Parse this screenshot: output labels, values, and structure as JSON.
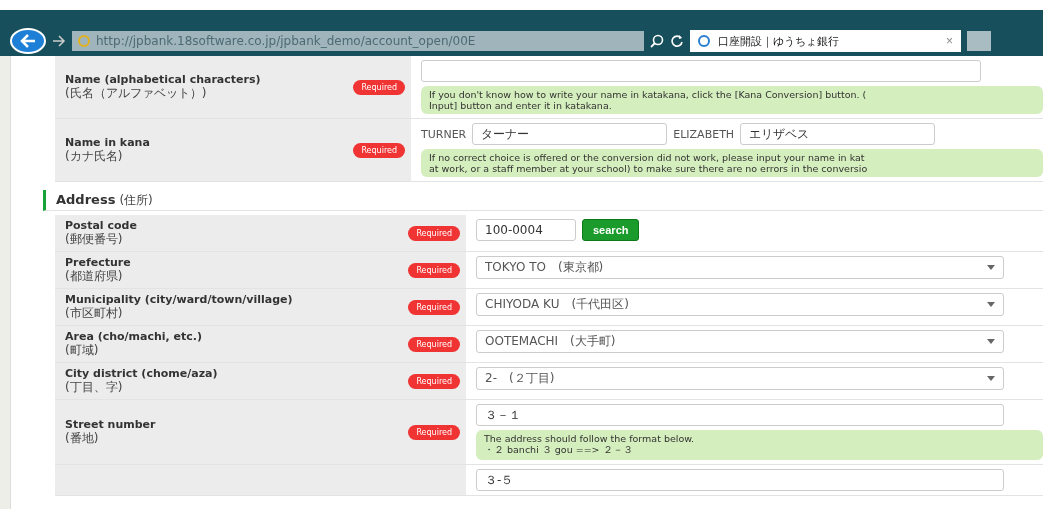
{
  "browser": {
    "url": "http://jpbank.18software.co.jp/jpbank_demo/account_open/00E",
    "tab_title": "口座開設｜ゆうちょ銀行",
    "tab_close": "×"
  },
  "name_rows": [
    {
      "kind": "alpha",
      "label": "Name (alphabetical characters)",
      "sub_label": "(氏名（アルファベット）)",
      "required": "Required",
      "note": [
        "If you don't know how to write your name in katakana, click the [Kana Conversion] button. (",
        "Input] button and enter it in katakana."
      ]
    },
    {
      "kind": "kana",
      "label": "Name in kana",
      "sub_label": "(カナ氏名)",
      "required": "Required",
      "fields": [
        {
          "prefix": "TURNER",
          "value": "ターナー"
        },
        {
          "prefix": "ELIZABETH",
          "value": "エリザベス"
        }
      ],
      "note": [
        "If no correct choice is offered or the conversion did not work, please input your name in kat",
        "at work, or a staff member at your school) to make sure there are no errors in the conversio"
      ]
    }
  ],
  "address": {
    "title": "Address",
    "sub_title": "(住所)",
    "rows": [
      {
        "kind": "postal",
        "label": "Postal code",
        "sub_label": "(郵便番号)",
        "required": "Required",
        "value": "100-0004",
        "button": "search"
      },
      {
        "kind": "select",
        "label": "Prefecture",
        "sub_label": "(都道府県)",
        "required": "Required",
        "value": "TOKYO TO　(東京都)"
      },
      {
        "kind": "select",
        "label": "Municipality (city/ward/town/village)",
        "sub_label": "(市区町村)",
        "required": "Required",
        "value": "CHIYODA KU　(千代田区)"
      },
      {
        "kind": "select",
        "label": "Area (cho/machi, etc.)",
        "sub_label": "(町域)",
        "required": "Required",
        "value": "OOTEMACHI　(大手町)"
      },
      {
        "kind": "select",
        "label": "City district (chome/aza)",
        "sub_label": "(丁目、字)",
        "required": "Required",
        "value": "2-　(２丁目)"
      },
      {
        "kind": "text",
        "label": "Street number",
        "sub_label": "(番地)",
        "required": "Required",
        "value": "３－１",
        "note": [
          "The address should follow the format below.",
          "・２ banchi ３ gou ==> ２－３"
        ]
      },
      {
        "kind": "partial",
        "value": "３-５"
      }
    ]
  }
}
